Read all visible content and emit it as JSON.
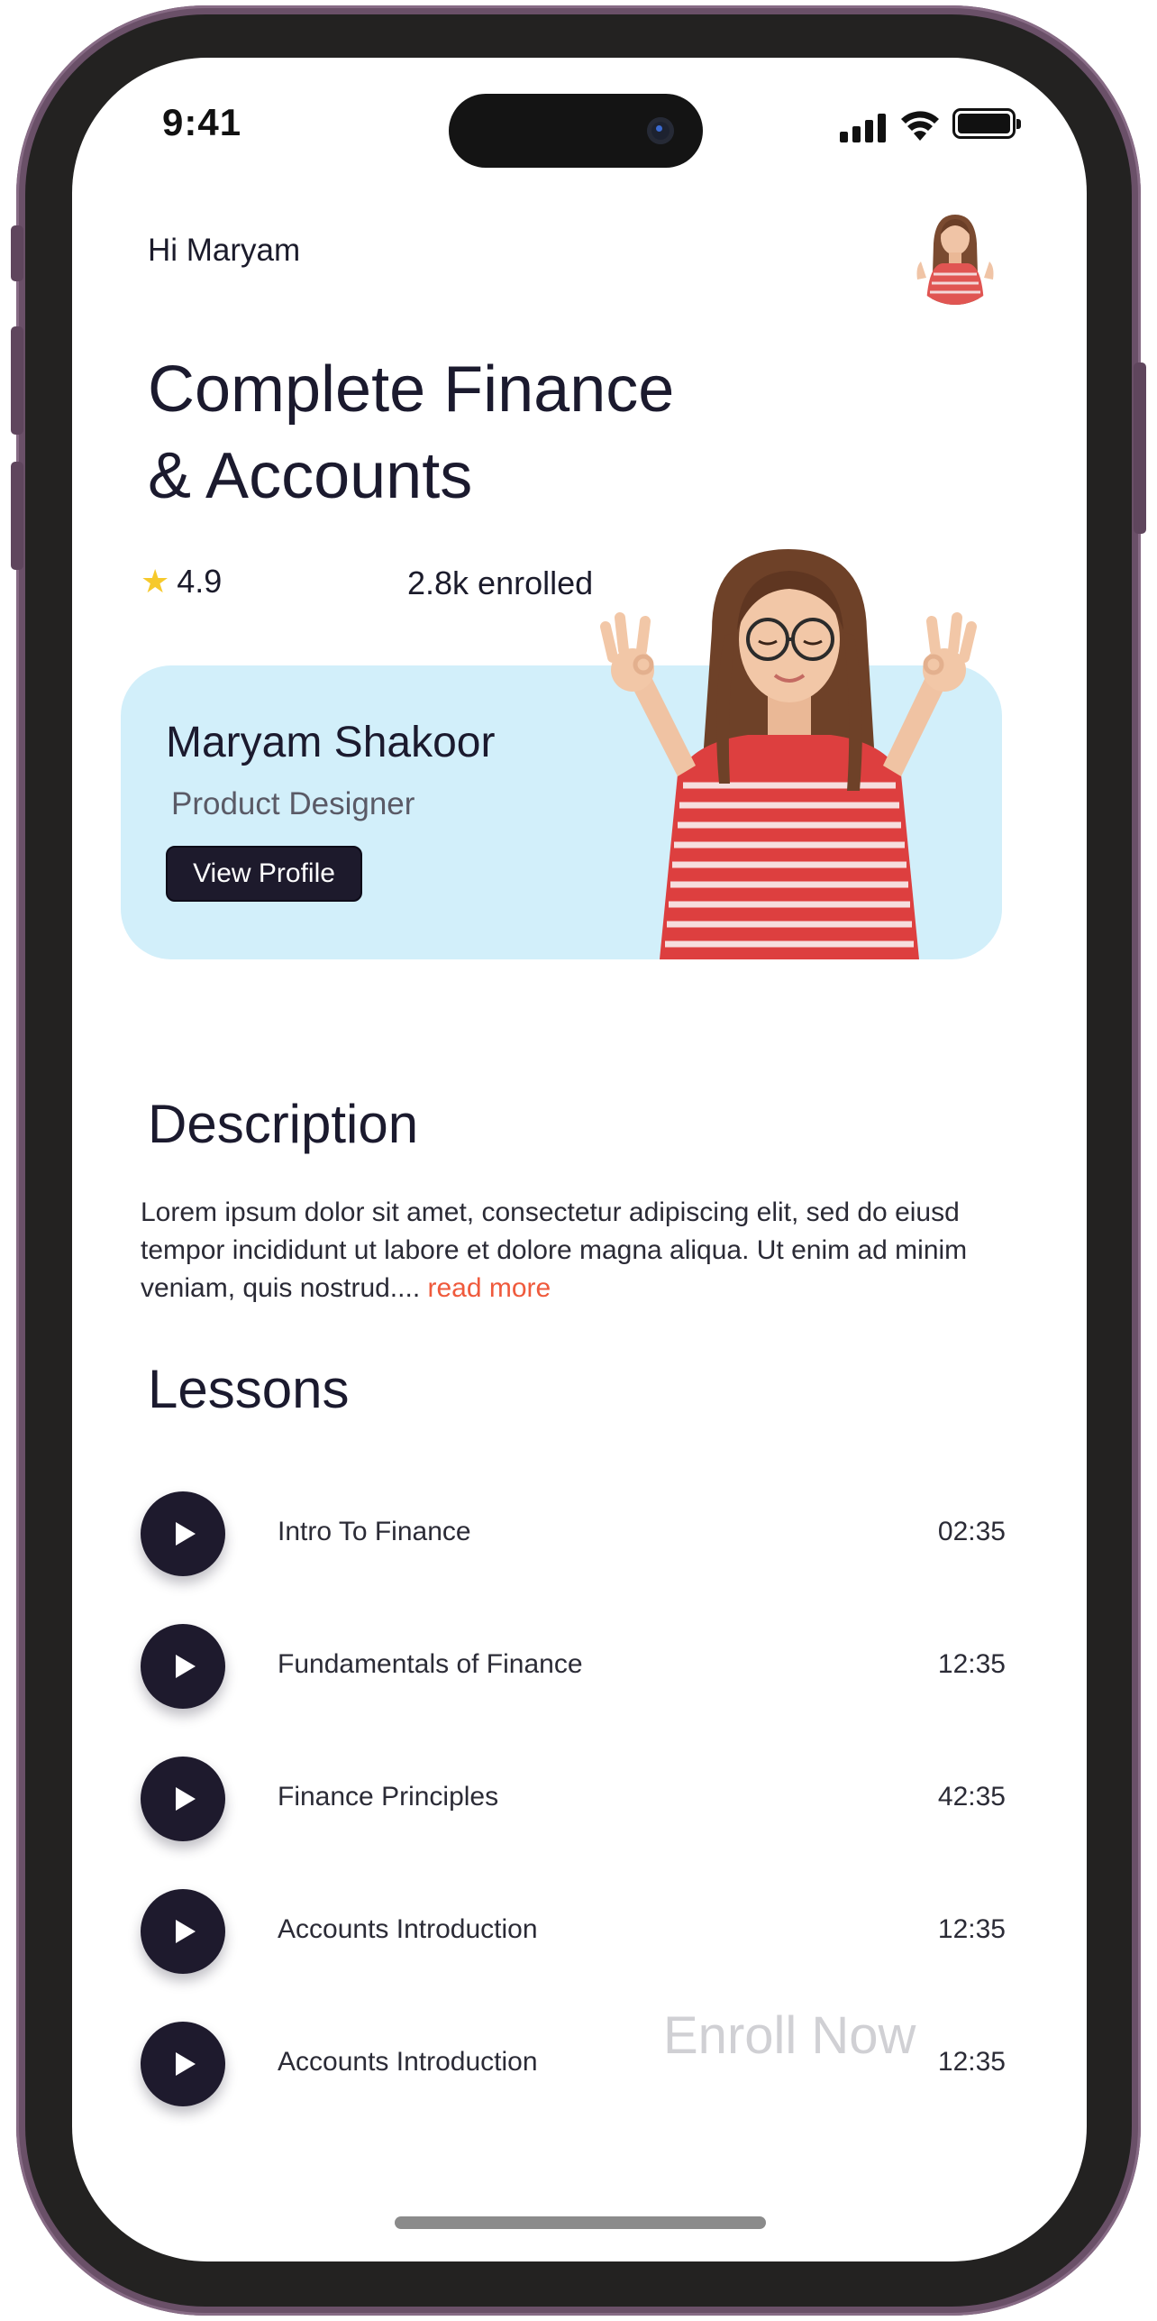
{
  "status_bar": {
    "time": "9:41"
  },
  "header": {
    "greeting": "Hi Maryam"
  },
  "course": {
    "title_line1": "Complete Finance",
    "title_line2": "& Accounts",
    "rating": "4.9",
    "enrolled": "2.8k enrolled"
  },
  "instructor": {
    "name": "Maryam Shakoor",
    "role": "Product Designer",
    "view_profile_label": "View Profile"
  },
  "description": {
    "heading": "Description",
    "text": "Lorem ipsum dolor sit amet, consectetur adipiscing elit, sed do eiusd tempor incididunt ut labore et dolore magna aliqua. Ut enim ad minim veniam, quis nostrud....",
    "read_more": "read more"
  },
  "lessons": {
    "heading": "Lessons",
    "items": [
      {
        "title": "Intro To Finance",
        "duration": "02:35"
      },
      {
        "title": "Fundamentals of Finance",
        "duration": "12:35"
      },
      {
        "title": "Finance Principles",
        "duration": "42:35"
      },
      {
        "title": "Accounts Introduction",
        "duration": "12:35"
      },
      {
        "title": "Accounts Introduction",
        "duration": "12:35"
      }
    ]
  },
  "enroll_label": "Enroll Now",
  "colors": {
    "card_bg": "#d2effa",
    "primary_dark": "#1e1a2d",
    "accent_link": "#ef5a3c",
    "star": "#f6c92c"
  }
}
